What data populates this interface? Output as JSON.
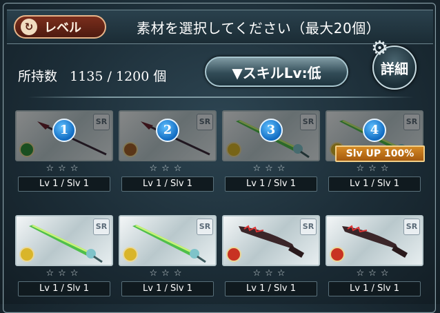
{
  "header": {
    "level_button_label": "レベル",
    "instruction": "素材を選択してください（最大20個）"
  },
  "inventory": {
    "label": "所持数",
    "count": "1135 / 1200 個"
  },
  "filter": {
    "label": "▼スキルLv:低"
  },
  "detail_button": {
    "label": "詳細"
  },
  "cards": [
    {
      "number": "1",
      "rarity": "SR",
      "stars": "☆☆☆",
      "level": "Lv 1 / Slv 1",
      "badge": "",
      "weapon": "spear",
      "element": "wind"
    },
    {
      "number": "2",
      "rarity": "SR",
      "stars": "☆☆☆",
      "level": "Lv 1 / Slv 1",
      "badge": "",
      "weapon": "spear",
      "element": "earth"
    },
    {
      "number": "3",
      "rarity": "SR",
      "stars": "☆☆☆",
      "level": "Lv 1 / Slv 1",
      "badge": "",
      "weapon": "sword",
      "element": "light"
    },
    {
      "number": "4",
      "rarity": "SR",
      "stars": "☆☆☆",
      "level": "Lv 1 / Slv 1",
      "badge": "Slv UP 100%",
      "weapon": "sword",
      "element": "light"
    },
    {
      "number": "",
      "rarity": "SR",
      "stars": "☆☆☆",
      "level": "Lv 1 / Slv 1",
      "badge": "",
      "weapon": "sword",
      "element": "light"
    },
    {
      "number": "",
      "rarity": "SR",
      "stars": "☆☆☆",
      "level": "Lv 1 / Slv 1",
      "badge": "",
      "weapon": "sword",
      "element": "light"
    },
    {
      "number": "",
      "rarity": "SR",
      "stars": "☆☆☆",
      "level": "Lv 1 / Slv 1",
      "badge": "",
      "weapon": "dagger",
      "element": "fire"
    },
    {
      "number": "",
      "rarity": "SR",
      "stars": "☆☆☆",
      "level": "Lv 1 / Slv 1",
      "badge": "",
      "weapon": "dagger",
      "element": "fire"
    }
  ],
  "colors": {
    "wind": "#2f8f3a",
    "earth": "#a4622c",
    "light": "#d9b52a",
    "fire": "#c83222",
    "number_badge": "#1679d1",
    "skill_up_badge": "#c7771b"
  }
}
